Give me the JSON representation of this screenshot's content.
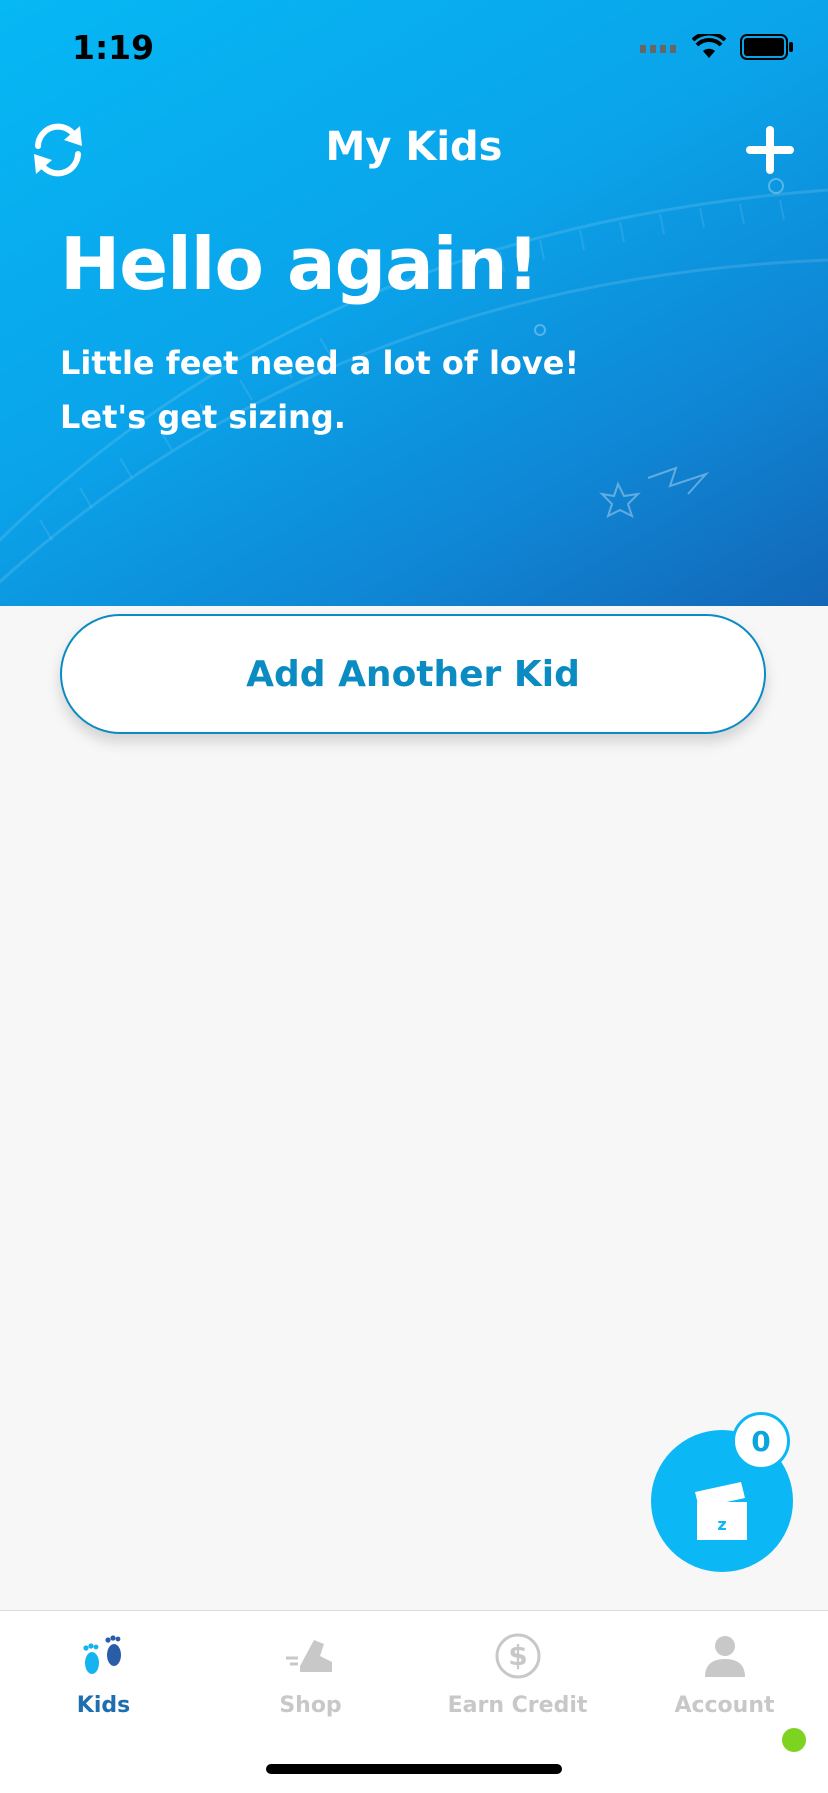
{
  "status_bar": {
    "time": "1:19"
  },
  "header": {
    "title": "My Kids"
  },
  "hero": {
    "greeting": "Hello again!",
    "line1": "Little feet need a lot of love!",
    "line2": "Let's get sizing."
  },
  "add_kid_button": {
    "label": "Add Another Kid"
  },
  "cart": {
    "count": "0"
  },
  "tabs": [
    {
      "label": "Kids",
      "icon": "feet-icon",
      "active": true
    },
    {
      "label": "Shop",
      "icon": "sneaker-icon",
      "active": false
    },
    {
      "label": "Earn Credit",
      "icon": "dollar-icon",
      "active": false
    },
    {
      "label": "Account",
      "icon": "person-icon",
      "active": false
    }
  ],
  "colors": {
    "brand_blue": "#0bb8f5",
    "button_text": "#0a8cc2",
    "active_tab": "#1f6fae",
    "inactive_tab": "#c8c8c8",
    "status_dot": "#7ed321"
  }
}
